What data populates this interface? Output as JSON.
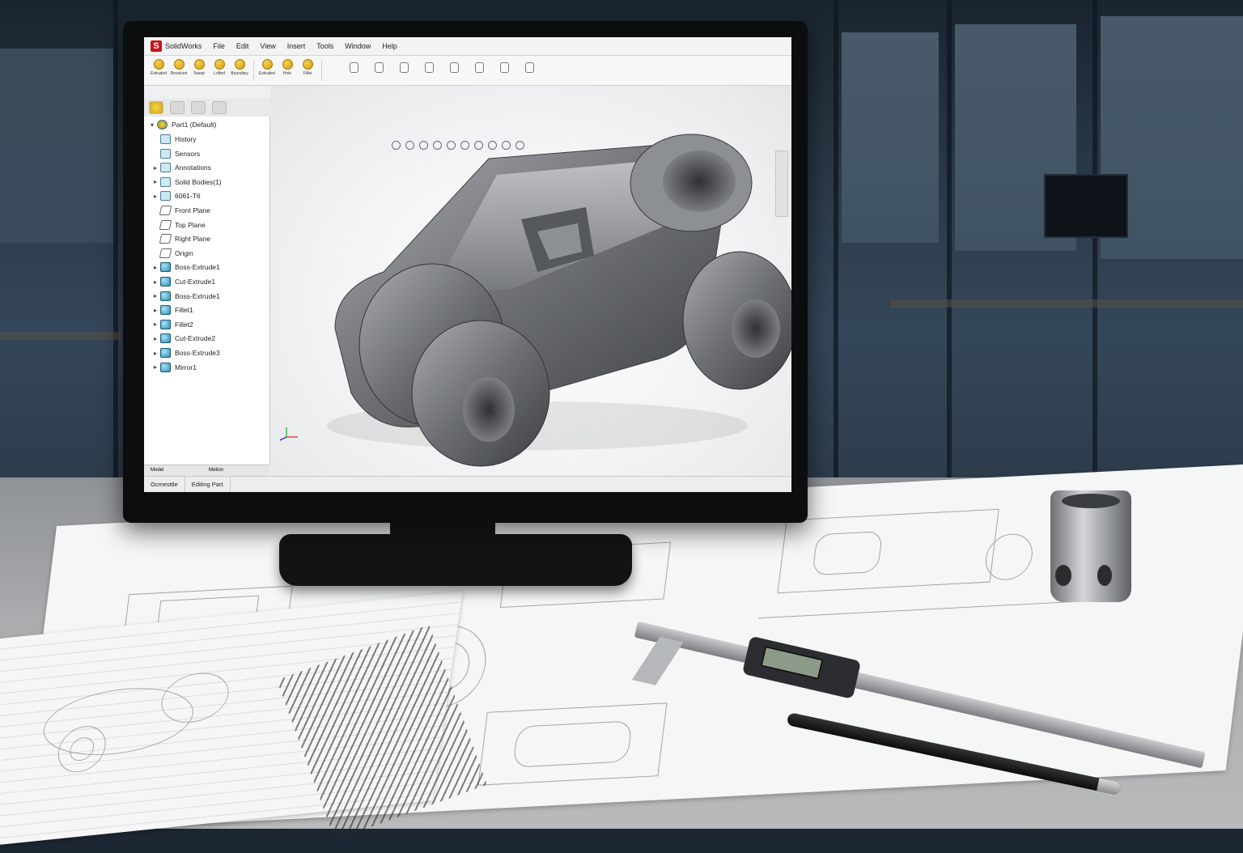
{
  "app": {
    "title": "SolidWorks",
    "menu": [
      "File",
      "Edit",
      "View",
      "Insert",
      "Tools",
      "Window",
      "Help"
    ]
  },
  "toolbar": {
    "buttons": [
      "Extruded",
      "Revolved",
      "Swept",
      "Lofted",
      "Boundary",
      "Extruded",
      "Hole",
      "Fillet"
    ]
  },
  "feature_tree": {
    "root": "Part1  (Default)",
    "items": [
      {
        "label": "History",
        "type": "folder",
        "expand": ""
      },
      {
        "label": "Sensors",
        "type": "folder",
        "expand": ""
      },
      {
        "label": "Annotations",
        "type": "folder",
        "expand": "▸"
      },
      {
        "label": "Solid Bodies(1)",
        "type": "folder",
        "expand": "▸"
      },
      {
        "label": "6061-T6",
        "type": "folder",
        "expand": "▸"
      },
      {
        "label": "Front Plane",
        "type": "plane",
        "expand": ""
      },
      {
        "label": "Top Plane",
        "type": "plane",
        "expand": ""
      },
      {
        "label": "Right Plane",
        "type": "plane",
        "expand": ""
      },
      {
        "label": "Origin",
        "type": "plane",
        "expand": ""
      },
      {
        "label": "Boss-Extrude1",
        "type": "feat",
        "expand": "▸"
      },
      {
        "label": "Cut-Extrude1",
        "type": "feat",
        "expand": "▸"
      },
      {
        "label": "Boss-Extrude1",
        "type": "feat",
        "expand": "▸"
      },
      {
        "label": "Fillet1",
        "type": "feat",
        "expand": "▸"
      },
      {
        "label": "Fillet2",
        "type": "feat",
        "expand": "▸"
      },
      {
        "label": "Cut-Extrude2",
        "type": "feat",
        "expand": "▸"
      },
      {
        "label": "Boss-Extrude3",
        "type": "feat",
        "expand": "▸"
      },
      {
        "label": "Mirror1",
        "type": "feat",
        "expand": "▸"
      }
    ]
  },
  "bottom_tabs": {
    "model": "Model",
    "motion": "Motion"
  },
  "status": {
    "left": "Ocmesttle",
    "right": "Editing Part"
  },
  "colors": {
    "brand": "#c8151b",
    "metal": "#6b6e72"
  }
}
